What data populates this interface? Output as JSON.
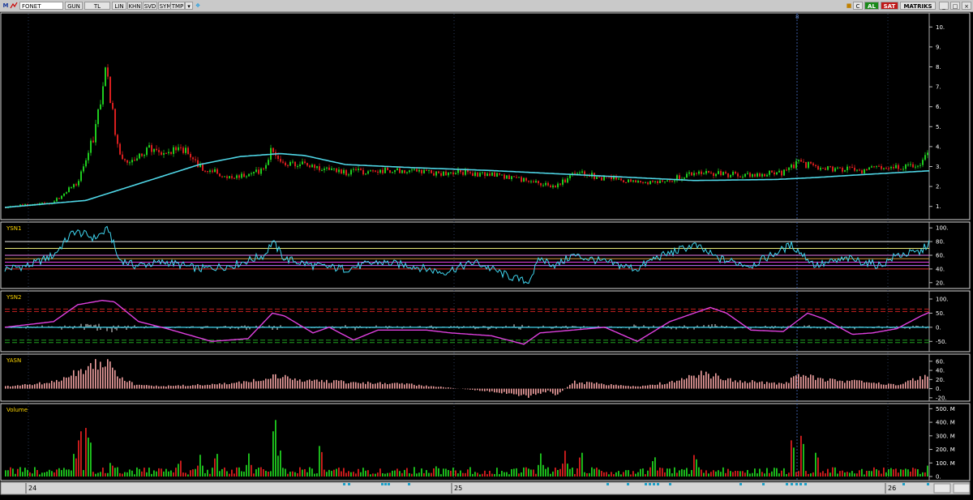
{
  "toolbar": {
    "m_label": "M",
    "symbol": "FONET",
    "buttons": [
      "GUN",
      "TL",
      "LIN",
      "KHN",
      "SVD",
      "SYM",
      "TMP"
    ],
    "right_buttons": [
      "C",
      "AL",
      "SAT",
      "MATRIKS"
    ],
    "colors": {
      "al": "#1a8a1a",
      "sat": "#c01818",
      "bg": "#c9c9c9"
    }
  },
  "chart_data": [
    {
      "panel": "price",
      "type": "candlestick",
      "ylim": [
        0.5,
        10.5
      ],
      "yticks": [
        "1.",
        "2.",
        "3.",
        "4.",
        "5.",
        "6.",
        "7.",
        "8.",
        "9.",
        "10."
      ],
      "marker": "8",
      "x_labels": [
        "24",
        "25",
        "26"
      ],
      "close_points": [
        [
          0,
          0.95
        ],
        [
          60,
          1.2
        ],
        [
          90,
          2.2
        ],
        [
          110,
          4.5
        ],
        [
          125,
          8
        ],
        [
          132,
          6
        ],
        [
          140,
          4
        ],
        [
          150,
          3.2
        ],
        [
          165,
          3.6
        ],
        [
          180,
          3.9
        ],
        [
          195,
          3.5
        ],
        [
          215,
          4.1
        ],
        [
          240,
          3
        ],
        [
          280,
          2.4
        ],
        [
          320,
          2.8
        ],
        [
          330,
          3.9
        ],
        [
          345,
          3.2
        ],
        [
          380,
          3.0
        ],
        [
          420,
          2.7
        ],
        [
          470,
          2.8
        ],
        [
          520,
          2.7
        ],
        [
          560,
          2.7
        ],
        [
          600,
          2.6
        ],
        [
          640,
          2.3
        ],
        [
          680,
          2.0
        ],
        [
          705,
          2.7
        ],
        [
          740,
          2.4
        ],
        [
          790,
          2.2
        ],
        [
          820,
          2.3
        ],
        [
          850,
          2.7
        ],
        [
          900,
          2.6
        ],
        [
          960,
          2.7
        ],
        [
          980,
          3.2
        ],
        [
          1000,
          3.0
        ],
        [
          1020,
          2.9
        ],
        [
          1060,
          2.8
        ],
        [
          1100,
          3.0
        ],
        [
          1130,
          3.2
        ],
        [
          1140,
          3.7
        ],
        [
          1146,
          3.3
        ]
      ],
      "ma_points": [
        [
          0,
          0.95
        ],
        [
          100,
          1.3
        ],
        [
          170,
          2.2
        ],
        [
          240,
          3.1
        ],
        [
          290,
          3.5
        ],
        [
          340,
          3.65
        ],
        [
          370,
          3.55
        ],
        [
          420,
          3.1
        ],
        [
          500,
          2.95
        ],
        [
          600,
          2.8
        ],
        [
          700,
          2.6
        ],
        [
          800,
          2.4
        ],
        [
          850,
          2.3
        ],
        [
          950,
          2.35
        ],
        [
          1000,
          2.45
        ],
        [
          1060,
          2.6
        ],
        [
          1146,
          2.8
        ]
      ]
    },
    {
      "panel": "ysn1",
      "title": "YSN1",
      "type": "line",
      "ylim": [
        15,
        105
      ],
      "yticks": [
        "20.",
        "40.",
        "60.",
        "80.",
        "100."
      ],
      "levels": [
        80,
        70,
        60,
        55,
        50,
        45,
        40
      ],
      "points": [
        [
          0,
          40
        ],
        [
          30,
          45
        ],
        [
          60,
          60
        ],
        [
          85,
          95
        ],
        [
          100,
          90
        ],
        [
          110,
          85
        ],
        [
          128,
          98
        ],
        [
          140,
          55
        ],
        [
          160,
          45
        ],
        [
          200,
          50
        ],
        [
          240,
          40
        ],
        [
          280,
          45
        ],
        [
          320,
          60
        ],
        [
          330,
          80
        ],
        [
          345,
          55
        ],
        [
          380,
          45
        ],
        [
          420,
          40
        ],
        [
          460,
          50
        ],
        [
          500,
          45
        ],
        [
          540,
          35
        ],
        [
          580,
          50
        ],
        [
          620,
          30
        ],
        [
          645,
          20
        ],
        [
          660,
          55
        ],
        [
          680,
          45
        ],
        [
          700,
          60
        ],
        [
          740,
          50
        ],
        [
          780,
          40
        ],
        [
          800,
          55
        ],
        [
          850,
          75
        ],
        [
          880,
          55
        ],
        [
          920,
          45
        ],
        [
          970,
          75
        ],
        [
          1000,
          45
        ],
        [
          1040,
          55
        ],
        [
          1080,
          45
        ],
        [
          1100,
          60
        ],
        [
          1130,
          65
        ],
        [
          1140,
          80
        ],
        [
          1146,
          55
        ]
      ]
    },
    {
      "panel": "ysn2",
      "title": "YSN2",
      "type": "line",
      "ylim": [
        -75,
        120
      ],
      "yticks": [
        "-50.",
        "0.",
        "50.",
        "100."
      ],
      "dashed_levels": [
        60,
        -50
      ],
      "points": [
        [
          0,
          0
        ],
        [
          60,
          20
        ],
        [
          90,
          80
        ],
        [
          120,
          95
        ],
        [
          135,
          90
        ],
        [
          165,
          20
        ],
        [
          200,
          -5
        ],
        [
          255,
          -50
        ],
        [
          300,
          -40
        ],
        [
          330,
          50
        ],
        [
          345,
          40
        ],
        [
          380,
          -20
        ],
        [
          400,
          0
        ],
        [
          430,
          -45
        ],
        [
          460,
          -10
        ],
        [
          520,
          -10
        ],
        [
          550,
          -20
        ],
        [
          600,
          -30
        ],
        [
          640,
          -60
        ],
        [
          660,
          -20
        ],
        [
          700,
          -10
        ],
        [
          740,
          0
        ],
        [
          780,
          -50
        ],
        [
          820,
          20
        ],
        [
          870,
          70
        ],
        [
          890,
          50
        ],
        [
          920,
          -10
        ],
        [
          960,
          -15
        ],
        [
          990,
          50
        ],
        [
          1010,
          30
        ],
        [
          1045,
          -25
        ],
        [
          1070,
          -20
        ],
        [
          1100,
          -5
        ],
        [
          1130,
          40
        ],
        [
          1146,
          60
        ]
      ]
    },
    {
      "panel": "yasn",
      "title": "YASN",
      "type": "bar",
      "ylim": [
        -22,
        72
      ],
      "yticks": [
        "-20.",
        "0.",
        "20.",
        "40.",
        "60."
      ],
      "points": [
        [
          0,
          5
        ],
        [
          60,
          15
        ],
        [
          90,
          40
        ],
        [
          128,
          70
        ],
        [
          140,
          30
        ],
        [
          160,
          8
        ],
        [
          200,
          6
        ],
        [
          260,
          10
        ],
        [
          300,
          15
        ],
        [
          330,
          30
        ],
        [
          360,
          20
        ],
        [
          420,
          15
        ],
        [
          500,
          10
        ],
        [
          560,
          0
        ],
        [
          620,
          -10
        ],
        [
          645,
          -18
        ],
        [
          670,
          -5
        ],
        [
          680,
          -15
        ],
        [
          700,
          15
        ],
        [
          780,
          5
        ],
        [
          820,
          15
        ],
        [
          860,
          35
        ],
        [
          900,
          20
        ],
        [
          960,
          10
        ],
        [
          980,
          35
        ],
        [
          1010,
          20
        ],
        [
          1060,
          15
        ],
        [
          1100,
          10
        ],
        [
          1140,
          30
        ],
        [
          1146,
          20
        ]
      ]
    },
    {
      "panel": "volume",
      "title": "Volume",
      "type": "bar",
      "ylim": [
        0,
        520
      ],
      "yticks": [
        "0.",
        "100. M",
        "200. M",
        "300. M",
        "400. M",
        "500. M"
      ],
      "spikes": [
        [
          85,
          200
        ],
        [
          92,
          400
        ],
        [
          100,
          430
        ],
        [
          104,
          300
        ],
        [
          130,
          120
        ],
        [
          215,
          140
        ],
        [
          240,
          160
        ],
        [
          260,
          200
        ],
        [
          300,
          170
        ],
        [
          332,
          500
        ],
        [
          338,
          230
        ],
        [
          388,
          270
        ],
        [
          530,
          90
        ],
        [
          660,
          170
        ],
        [
          690,
          190
        ],
        [
          710,
          210
        ],
        [
          800,
          170
        ],
        [
          850,
          190
        ],
        [
          970,
          320
        ],
        [
          982,
          360
        ],
        [
          1000,
          210
        ],
        [
          1140,
          160
        ]
      ]
    }
  ]
}
